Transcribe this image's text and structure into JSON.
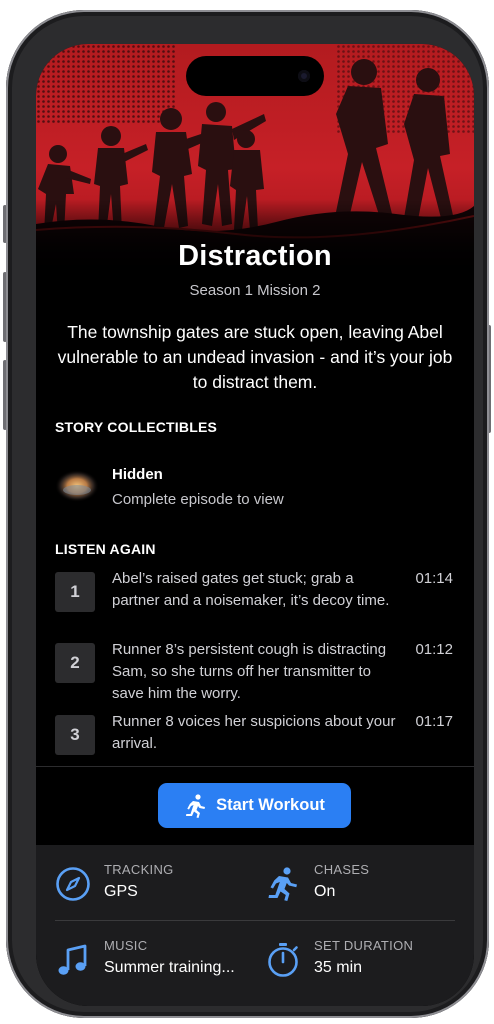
{
  "episode": {
    "title": "Distraction",
    "subtitle": "Season 1 Mission 2",
    "description": "The township gates are stuck open, leaving Abel vulnerable to an undead invasion - and it’s your job to distract them."
  },
  "collectibles": {
    "header": "STORY COLLECTIBLES",
    "item": {
      "title": "Hidden",
      "subtitle": "Complete episode to view",
      "icon": "hidden-collectible-icon"
    }
  },
  "listen_again": {
    "header": "LISTEN AGAIN",
    "items": [
      {
        "number": "1",
        "text": "Abel’s raised gates get stuck; grab a partner and a noisemaker, it’s decoy time.",
        "duration": "01:14"
      },
      {
        "number": "2",
        "text": "Runner 8’s persistent cough is distracting Sam, so she turns off her transmitter to save him the worry.",
        "duration": "01:12"
      },
      {
        "number": "3",
        "text": "Runner 8 voices her suspicions about your arrival.",
        "duration": "01:17"
      }
    ]
  },
  "start_button": {
    "label": "Start Workout",
    "icon": "running-person-icon",
    "color": "#2B7FF3"
  },
  "settings": {
    "tracking": {
      "label": "TRACKING",
      "value": "GPS",
      "icon": "compass-icon"
    },
    "chases": {
      "label": "CHASES",
      "value": "On",
      "icon": "running-person-icon"
    },
    "music": {
      "label": "MUSIC",
      "value": "Summer training...",
      "icon": "music-note-icon"
    },
    "duration": {
      "label": "SET DURATION",
      "value": "35 min",
      "icon": "stopwatch-icon"
    }
  },
  "colors": {
    "hero_red": "#C62027",
    "accent_blue": "#2B7FF3",
    "background": "#000000",
    "panel": "#1C1C1E"
  }
}
